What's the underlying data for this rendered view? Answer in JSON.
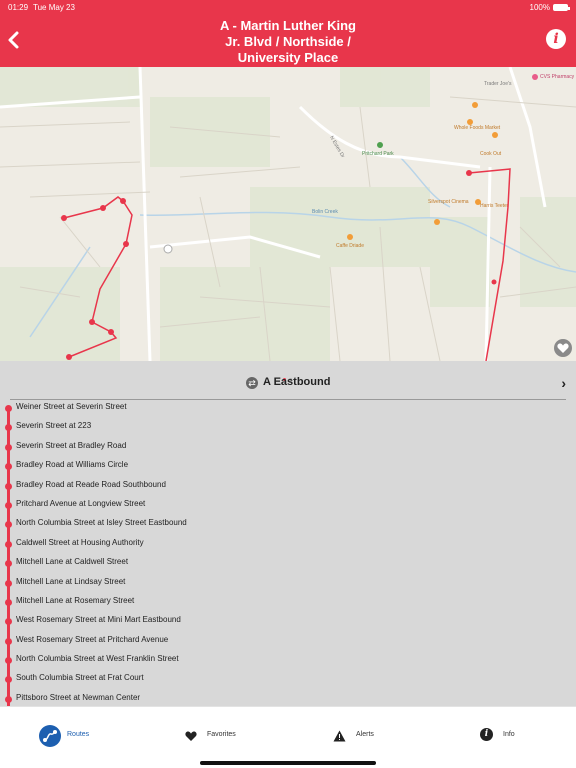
{
  "status_bar": {
    "time": "01:29",
    "date": "Tue May 23",
    "battery": "100%"
  },
  "header": {
    "title_line1": "A - Martin Luther King",
    "title_line2": "Jr. Blvd / Northside /",
    "title_line3": "University Place",
    "back_icon": "chevron-left-icon",
    "info_icon": "info-icon",
    "accent_color": "#e8364b"
  },
  "map": {
    "labels": {
      "trader_joes": "Trader Joe's",
      "cvs": "CVS Pharmacy",
      "pritchard_park": "Pritchard Park",
      "silverspot": "Silverspot Cinema",
      "cook_out": "Cook Out",
      "bolin_creek": "Bolin Creek",
      "caffe": "Caffe Driade",
      "harris_teeter": "Harris Teeter",
      "n_estes": "N Estes Dr",
      "whole_foods": "Whole Foods Market"
    }
  },
  "panel": {
    "page_dots": 2,
    "active_dot": 0,
    "direction": "A Eastbound",
    "next_icon": "chevron-right-icon",
    "stops": [
      "Weiner Street at Severin Street",
      "Severin Street at 223",
      "Severin Street at Bradley Road",
      "Bradley Road at Williams Circle",
      "Bradley Road at Reade Road Southbound",
      "Pritchard Avenue at Longview Street",
      "North Columbia Street at Isley Street Eastbound",
      "Caldwell Street at Housing Authority",
      "Mitchell Lane at Caldwell Street",
      "Mitchell Lane at Lindsay Street",
      "Mitchell Lane at Rosemary Street",
      "West Rosemary Street at Mini Mart Eastbound",
      "West Rosemary Street at Pritchard Avenue",
      "North Columbia Street at West Franklin Street",
      "South Columbia Street at Frat Court",
      "Pittsboro Street at Newman Center"
    ]
  },
  "tabs": {
    "routes": "Routes",
    "favorites": "Favorites",
    "alerts": "Alerts",
    "info": "Info"
  }
}
